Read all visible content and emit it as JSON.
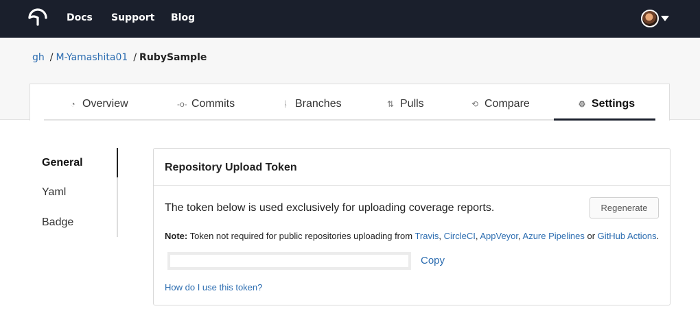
{
  "topnav": {
    "links": [
      "Docs",
      "Support",
      "Blog"
    ]
  },
  "breadcrumb": {
    "provider": "gh",
    "owner": "M-Yamashita01",
    "repo": "RubySample",
    "separator": "/"
  },
  "tabs": [
    {
      "label": "Overview",
      "icon": "overview-icon"
    },
    {
      "label": "Commits",
      "icon": "commit-icon"
    },
    {
      "label": "Branches",
      "icon": "branch-icon"
    },
    {
      "label": "Pulls",
      "icon": "pull-request-icon"
    },
    {
      "label": "Compare",
      "icon": "compare-icon"
    },
    {
      "label": "Settings",
      "icon": "gear-icon",
      "active": true
    }
  ],
  "sidebar": {
    "items": [
      "General",
      "Yaml",
      "Badge"
    ],
    "active": "General"
  },
  "token_card": {
    "title": "Repository Upload Token",
    "description": "The token below is used exclusively for uploading coverage reports.",
    "regenerate_label": "Regenerate",
    "note_label": "Note:",
    "note_text": "Token not required for public repositories uploading from",
    "ci_links": [
      "Travis",
      "CircleCI",
      "AppVeyor",
      "Azure Pipelines",
      "GitHub Actions"
    ],
    "note_or": "or",
    "token_value": "",
    "copy_label": "Copy",
    "help_link": "How do I use this token?"
  },
  "colors": {
    "topbar": "#1a1f2c",
    "link": "#2b6cb0"
  }
}
